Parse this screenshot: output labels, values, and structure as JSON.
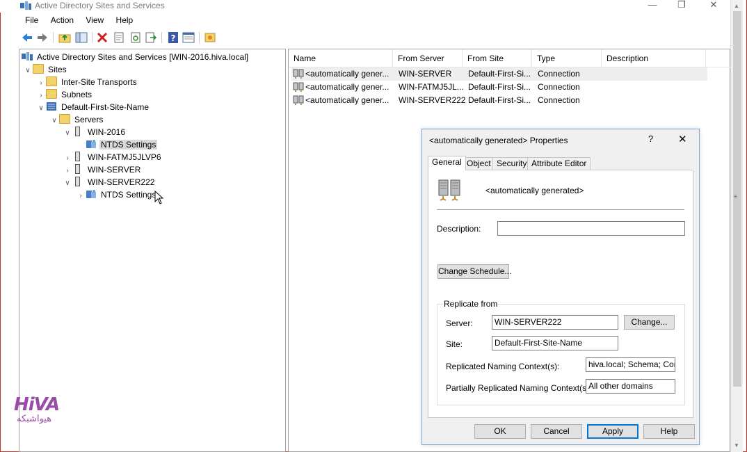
{
  "window": {
    "title": "Active Directory Sites and Services",
    "minimize": "—",
    "maximize": "❐",
    "close": "✕"
  },
  "menu": [
    "File",
    "Action",
    "View",
    "Help"
  ],
  "toolbar_icons": [
    "back-arrow",
    "forward-arrow",
    "up-folder",
    "show-hide-tree",
    "delete",
    "properties-sheet",
    "refresh",
    "export-list",
    "help",
    "console-view",
    "new-object"
  ],
  "tree": {
    "root": "Active Directory Sites and Services [WIN-2016.hiva.local]",
    "sites": "Sites",
    "inter_site": "Inter-Site Transports",
    "subnets": "Subnets",
    "site": "Default-First-Site-Name",
    "servers": "Servers",
    "server1": "WIN-2016",
    "ntds1": "NTDS Settings",
    "server2": "WIN-FATMJ5JLVP6",
    "server3": "WIN-SERVER",
    "server4": "WIN-SERVER222",
    "ntds2": "NTDS Settings"
  },
  "list": {
    "columns": [
      "Name",
      "From Server",
      "From Site",
      "Type",
      "Description"
    ],
    "rows": [
      {
        "name": "<automatically gener...",
        "from_server": "WIN-SERVER",
        "from_site": "Default-First-Si...",
        "type": "Connection",
        "description": ""
      },
      {
        "name": "<automatically gener...",
        "from_server": "WIN-FATMJ5JL...",
        "from_site": "Default-First-Si...",
        "type": "Connection",
        "description": ""
      },
      {
        "name": "<automatically gener...",
        "from_server": "WIN-SERVER222",
        "from_site": "Default-First-Si...",
        "type": "Connection",
        "description": ""
      }
    ]
  },
  "dialog": {
    "title": "<automatically generated> Properties",
    "help": "?",
    "close": "✕",
    "tabs": [
      "General",
      "Object",
      "Security",
      "Attribute Editor"
    ],
    "object_name": "<automatically generated>",
    "description_label": "Description:",
    "description_value": "",
    "change_schedule": "Change Schedule...",
    "replicate_from": "Replicate from",
    "server_label": "Server:",
    "server_value": "WIN-SERVER222",
    "change_button": "Change...",
    "site_label": "Site:",
    "site_value": "Default-First-Site-Name",
    "rnc_label": "Replicated Naming Context(s):",
    "rnc_value": "hiva.local; Schema; Config",
    "prnc_label": "Partially Replicated Naming Context(s):",
    "prnc_value": "All other domains",
    "ok": "OK",
    "cancel": "Cancel",
    "apply": "Apply",
    "help_button": "Help"
  },
  "watermark": {
    "brand": "HiVA",
    "sub": "هیواشبکه"
  },
  "colors": {
    "accent": "#0078d7",
    "selection": "#d9d9d9",
    "watermark": "#9a4aa8",
    "folder": "#f3d26a",
    "frame_border": "#c9372c"
  }
}
